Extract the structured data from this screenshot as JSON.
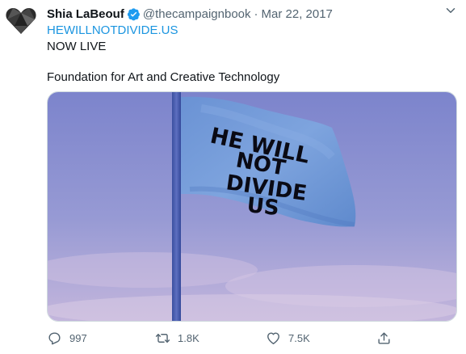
{
  "tweet": {
    "author_name": "Shia LaBeouf",
    "handle": "@thecampaignbook",
    "separator": "·",
    "date": "Mar 22, 2017",
    "link_text": "HEWILLNOTDIVIDE.US",
    "line1": "NOW LIVE",
    "line2": "Foundation for Art and Creative Technology",
    "verified_icon": "verified-badge-icon",
    "accent_color": "#1b95e0"
  },
  "media": {
    "flag_text_lines": [
      "HE WILL",
      "NOT",
      "DIVIDE",
      "US"
    ],
    "sky_color_top": "#7f86cc",
    "flag_color": "#6c97d6"
  },
  "actions": {
    "reply_count": "997",
    "retweet_count": "1.8K",
    "like_count": "7.5K"
  }
}
